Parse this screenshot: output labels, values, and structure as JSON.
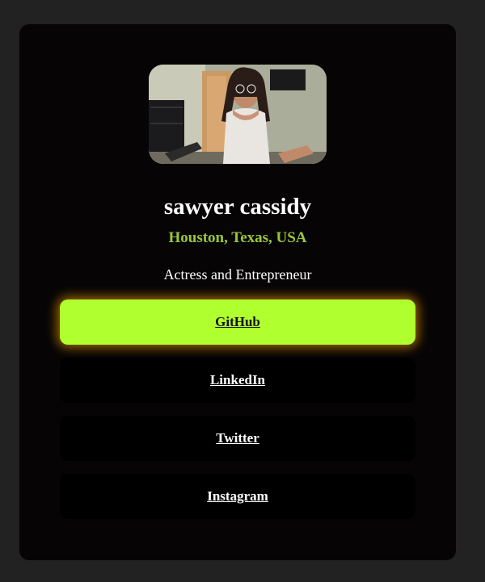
{
  "profile": {
    "name": "sawyer cassidy",
    "location": "Houston, Texas, USA",
    "bio": "Actress and Entrepreneur",
    "avatar_alt": "profile photo"
  },
  "links": [
    {
      "label": "GitHub",
      "highlighted": true
    },
    {
      "label": "LinkedIn",
      "highlighted": false
    },
    {
      "label": "Twitter",
      "highlighted": false
    },
    {
      "label": "Instagram",
      "highlighted": false
    }
  ],
  "colors": {
    "page_bg": "#232223",
    "card_bg": "#060405",
    "accent": "#b0ff2e",
    "location_text": "#9ac73a",
    "glow": "#c48000"
  }
}
